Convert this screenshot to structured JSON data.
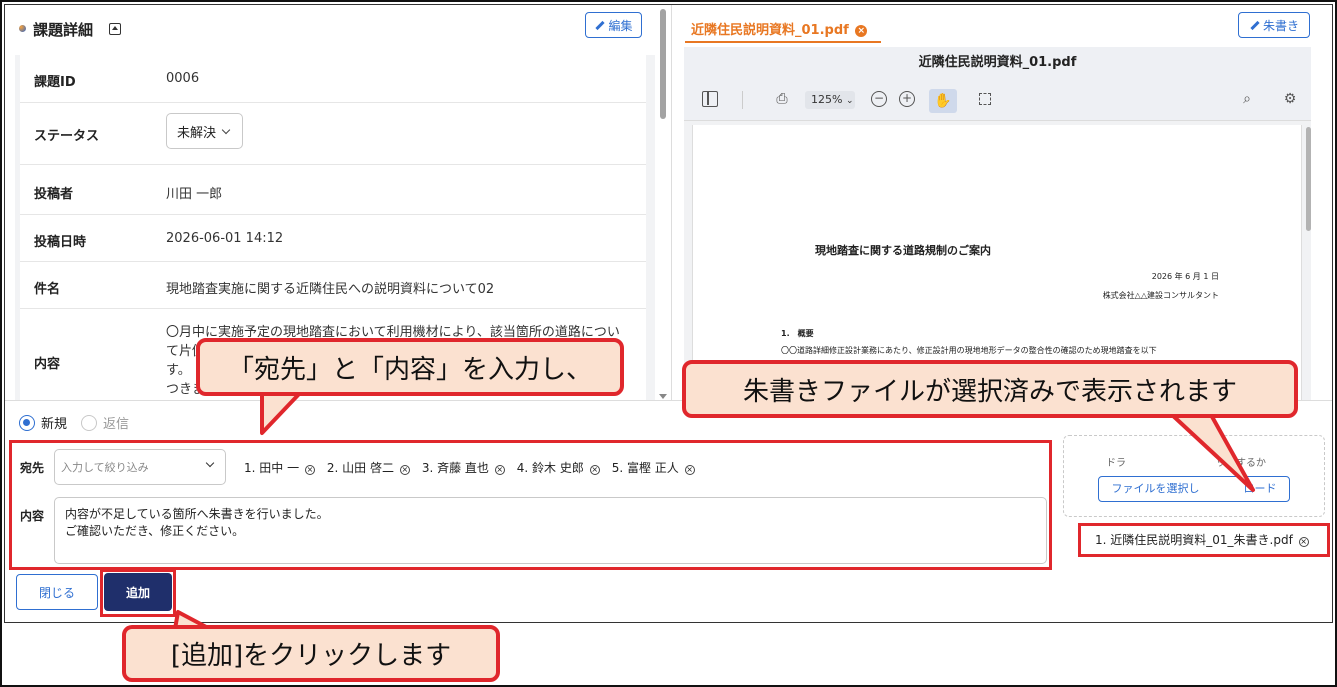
{
  "left": {
    "title": "課題詳細",
    "edit_label": "編集",
    "rows": [
      {
        "label": "課題ID",
        "value": "0006"
      },
      {
        "label": "ステータス",
        "value": "未解決"
      },
      {
        "label": "投稿者",
        "value": "川田 一郎"
      },
      {
        "label": "投稿日時",
        "value": "2026-06-01 14:12"
      },
      {
        "label": "件名",
        "value": "現地踏査実施に関する近隣住民への説明資料について02"
      },
      {
        "label": "内容",
        "value": "〇月中に実施予定の現地踏査において利用機材により、該当箇所の道路について片側…す。 つきま…"
      }
    ],
    "content_line1": "〇月中に実施予定の現地踏査において利用機材により、該当箇所の道路につい",
    "content_line2": "て片側",
    "content_line3": "す。",
    "content_line4": "つきま"
  },
  "viewer": {
    "tab_label": "近隣住民説明資料_01.pdf",
    "redline_label": "朱書き",
    "title": "近隣住民説明資料_01.pdf",
    "zoom": "125%",
    "page": {
      "heading": "現地踏査に関する道路規制のご案内",
      "date": "2026 年 6 月 1 日",
      "company": "株式会社△△建設コンサルタント",
      "section": "1.　概要",
      "body": "〇〇道路詳細修正設計業務にあたり、修正設計用の現地地形データの整合性の確認のため現地踏査を以下"
    }
  },
  "form": {
    "mode_new": "新規",
    "mode_reply": "返信",
    "to_label": "宛先",
    "filter_placeholder": "入力して絞り込み",
    "recipients": [
      "1. 田中 一",
      "2. 山田 啓二",
      "3. 斉藤 直也",
      "4. 鈴木 史郎",
      "5. 富樫 正人"
    ],
    "content_label": "内容",
    "message_line1": "内容が不足している箇所へ朱書きを行いました。",
    "message_line2": "ご確認いただき、修正ください。",
    "drop_text": "ドラ　　　　　　　　　ップするか",
    "choose_file": "ファイルを選択し　　　　ロード",
    "attached_file": "1. 近隣住民説明資料_01_朱書き.pdf",
    "close_label": "閉じる",
    "add_label": "追加"
  },
  "callouts": {
    "input": "「宛先」と「内容」を入力し、",
    "file": "朱書きファイルが選択済みで表示されます",
    "click": "[追加]をクリックします"
  },
  "colors": {
    "accent": "#2f6fd1",
    "tab_orange": "#e87722",
    "highlight_red": "#e0272c",
    "callout_fill": "#fbe1d0",
    "primary_button": "#1f2f6b"
  }
}
